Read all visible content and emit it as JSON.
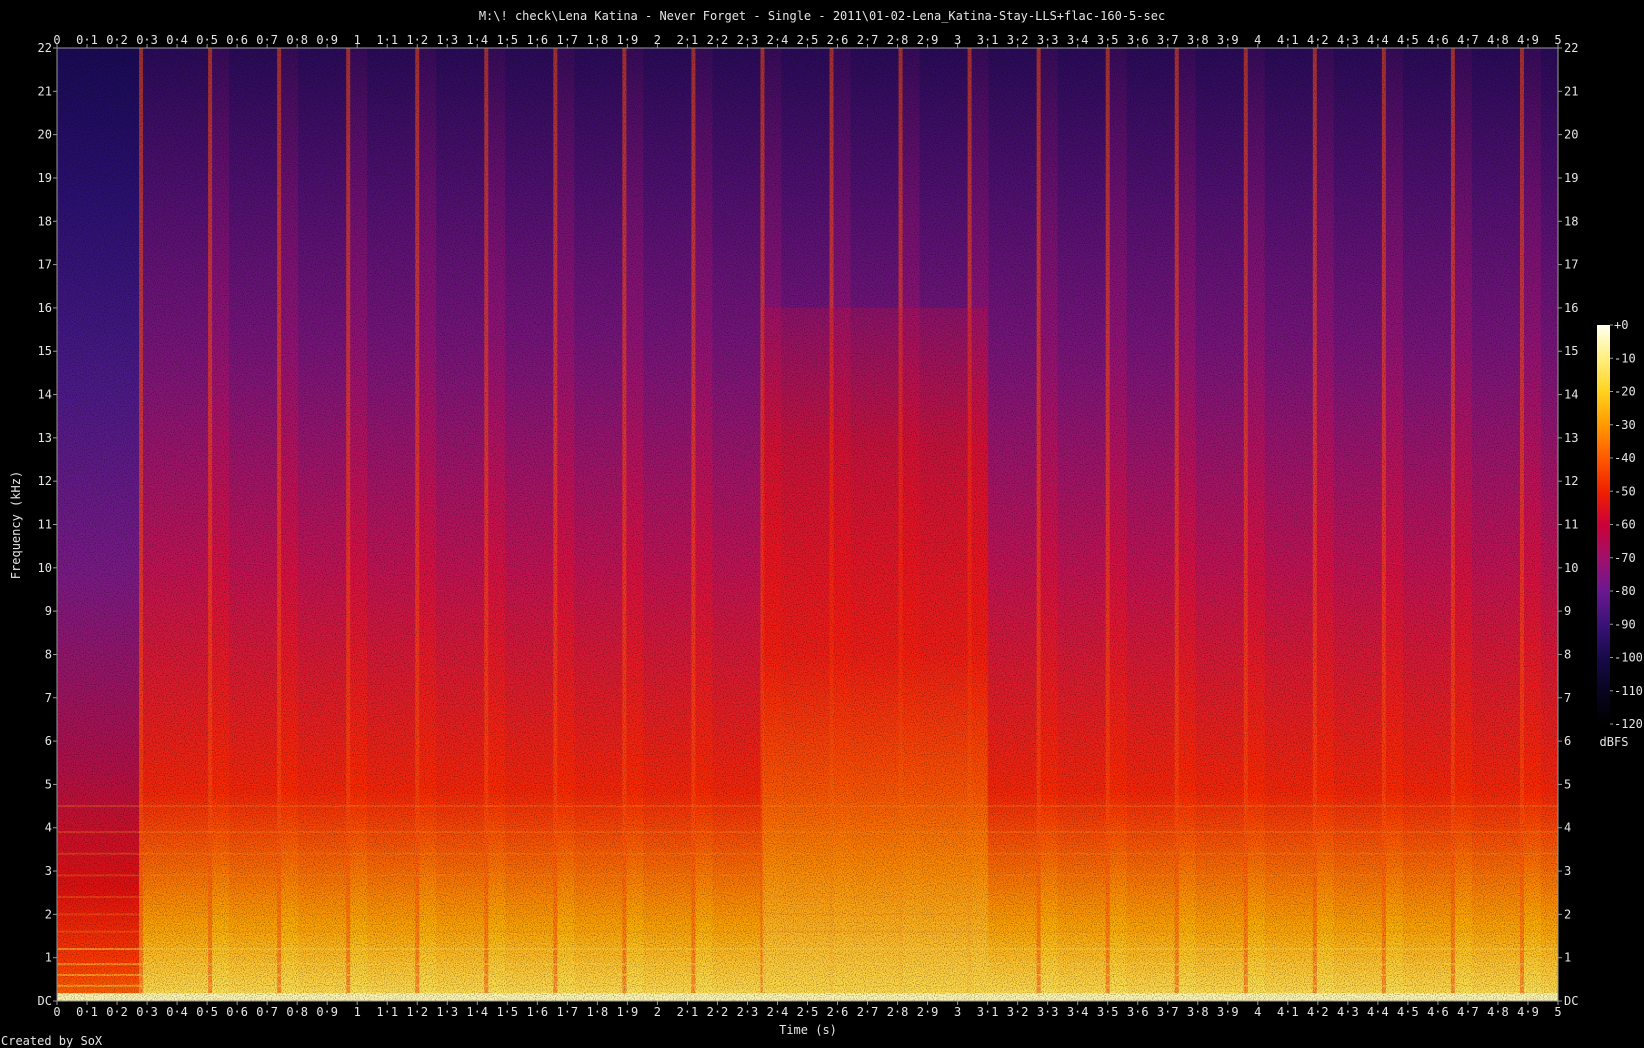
{
  "chart_data": {
    "type": "heatmap",
    "title": "M:\\! check\\Lena Katina - Never Forget - Single - 2011\\01-02-Lena_Katina-Stay-LLS+flac-160-5-sec",
    "xlabel": "Time (s)",
    "ylabel": "Frequency (kHz)",
    "colorbar_label": "dBFS",
    "footer": "Created by SoX",
    "xlim": [
      0,
      5
    ],
    "ylim": [
      0,
      22
    ],
    "zlim": [
      -120,
      0
    ],
    "x_ticks": [
      "0",
      "0·1",
      "0·2",
      "0·3",
      "0·4",
      "0·5",
      "0·6",
      "0·7",
      "0·8",
      "0·9",
      "1",
      "1·1",
      "1·2",
      "1·3",
      "1·4",
      "1·5",
      "1·6",
      "1·7",
      "1·8",
      "1·9",
      "2",
      "2·1",
      "2·2",
      "2·3",
      "2·4",
      "2·5",
      "2·6",
      "2·7",
      "2·8",
      "2·9",
      "3",
      "3·1",
      "3·2",
      "3·3",
      "3·4",
      "3·5",
      "3·6",
      "3·7",
      "3·8",
      "3·9",
      "4",
      "4·1",
      "4·2",
      "4·3",
      "4·4",
      "4·5",
      "4·6",
      "4·7",
      "4·8",
      "4·9",
      "5"
    ],
    "y_ticks": [
      "DC",
      "1",
      "2",
      "3",
      "4",
      "5",
      "6",
      "7",
      "8",
      "9",
      "10",
      "11",
      "12",
      "13",
      "14",
      "15",
      "16",
      "17",
      "18",
      "19",
      "20",
      "21",
      "22"
    ],
    "z_ticks": [
      "+0",
      "-10",
      "-20",
      "-30",
      "-40",
      "-50",
      "-60",
      "-70",
      "-80",
      "-90",
      "-100",
      "-110",
      "-120"
    ],
    "colormap": [
      "#fffff2",
      "#fff080",
      "#ffd21e",
      "#ff9a00",
      "#ff5a00",
      "#f02000",
      "#cc0038",
      "#a0106a",
      "#6a1890",
      "#3a1278",
      "#180a4a",
      "#080420",
      "#000000"
    ],
    "onsets_s": [
      0.28,
      0.51,
      0.74,
      0.97,
      1.2,
      1.43,
      1.66,
      1.89,
      2.12,
      2.35,
      2.58,
      2.81,
      3.04,
      3.27,
      3.5,
      3.73,
      3.96,
      4.19,
      4.42,
      4.65,
      4.88
    ],
    "dense_region_s": [
      2.35,
      3.1
    ]
  }
}
